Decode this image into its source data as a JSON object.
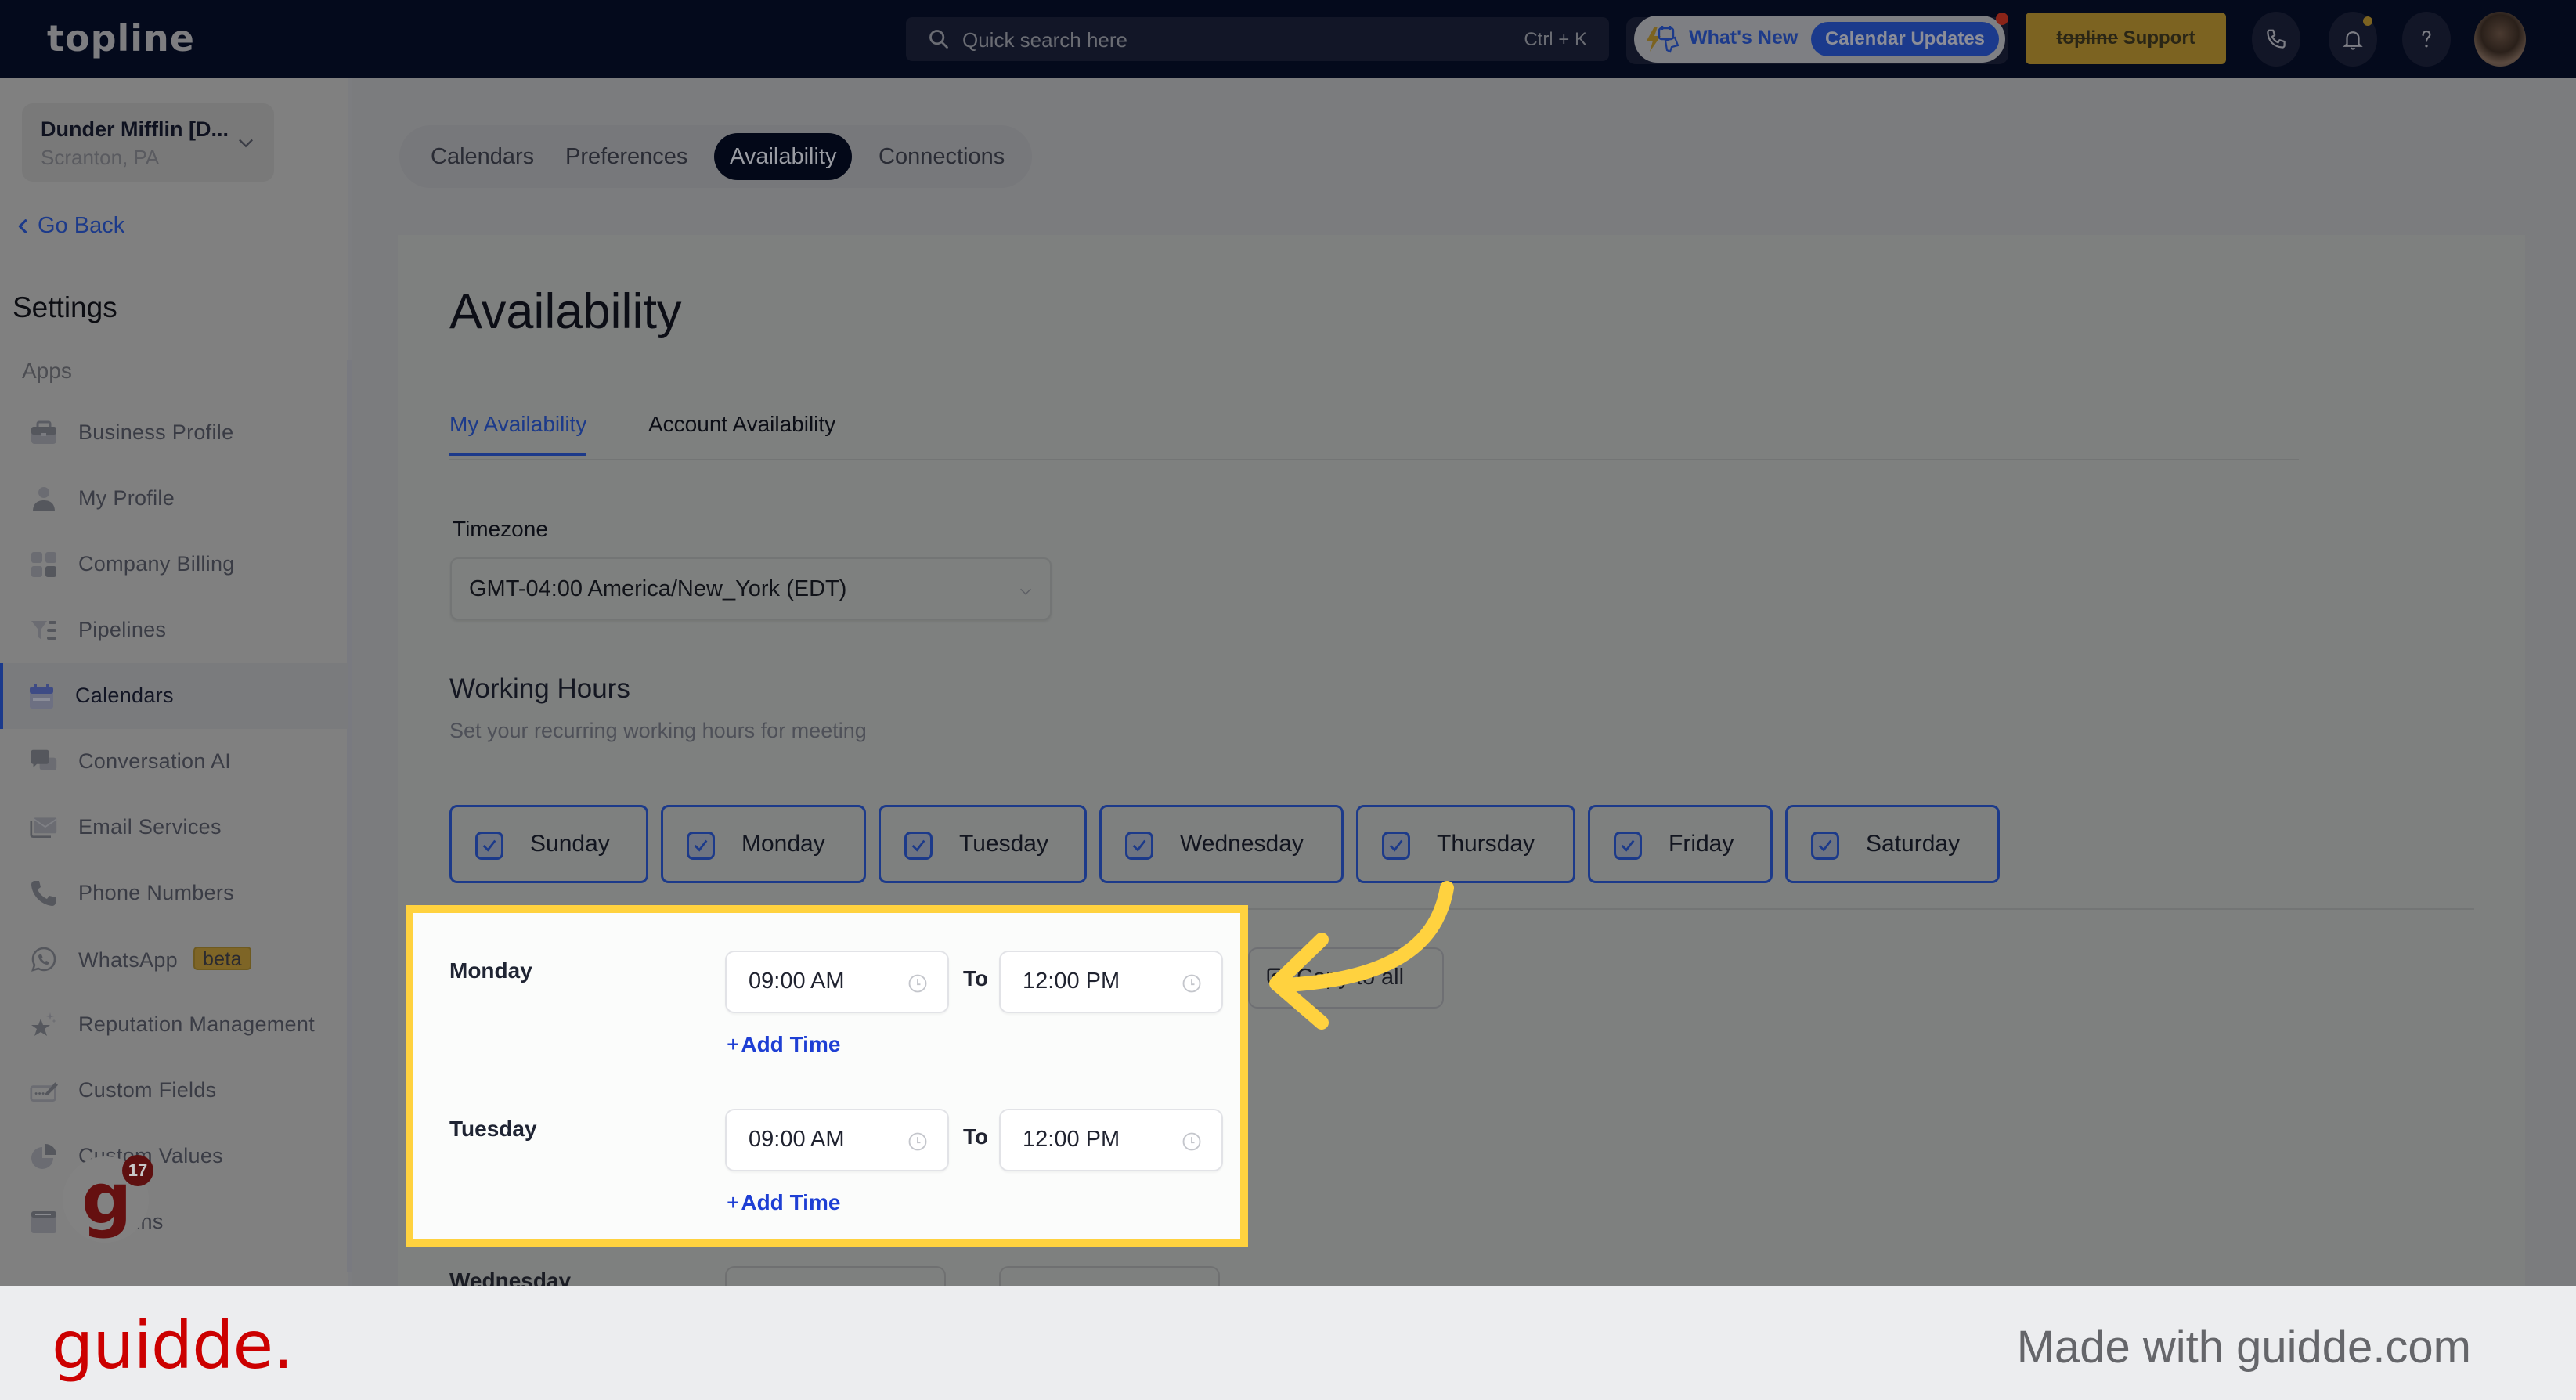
{
  "topbar": {
    "logo": "topline",
    "search_placeholder": "Quick search here",
    "search_shortcut": "Ctrl + K",
    "whats_new_label": "What's New",
    "whats_new_pill": "Calendar Updates",
    "support_brand": "topline",
    "support_label": " Support",
    "icons": [
      "phone-icon",
      "bell-icon",
      "help-icon",
      "avatar"
    ]
  },
  "sidebar": {
    "location_name": "Dunder Mifflin [D...",
    "location_sub": "Scranton, PA",
    "go_back": "Go Back",
    "section_title": "Settings",
    "group_label": "Apps",
    "items": [
      {
        "label": "Business Profile",
        "icon": "briefcase-icon"
      },
      {
        "label": "My Profile",
        "icon": "user-icon"
      },
      {
        "label": "Company Billing",
        "icon": "calculator-icon"
      },
      {
        "label": "Pipelines",
        "icon": "funnel-icon"
      },
      {
        "label": "Calendars",
        "icon": "calendar-icon",
        "active": true
      },
      {
        "label": "Conversation AI",
        "icon": "chat-bubbles-icon"
      },
      {
        "label": "Email Services",
        "icon": "envelope-icon"
      },
      {
        "label": "Phone Numbers",
        "icon": "phone-icon"
      },
      {
        "label": "WhatsApp",
        "icon": "whatsapp-icon",
        "badge": "beta"
      },
      {
        "label": "Reputation Management",
        "icon": "star-sparkle-icon"
      },
      {
        "label": "Custom Fields",
        "icon": "edit-field-icon"
      },
      {
        "label": "Custom Values",
        "icon": "pie-chart-icon"
      },
      {
        "label": "Domains",
        "icon": "browser-window-icon"
      }
    ],
    "fab_badge": "17"
  },
  "main": {
    "top_tabs": [
      {
        "label": "Calendars"
      },
      {
        "label": "Preferences"
      },
      {
        "label": "Availability",
        "active": true
      },
      {
        "label": "Connections"
      }
    ],
    "page_title": "Availability",
    "sub_tabs": [
      {
        "label": "My Availability",
        "active": true
      },
      {
        "label": "Account Availability"
      }
    ],
    "timezone_label": "Timezone",
    "timezone_value": "GMT-04:00 America/New_York (EDT)",
    "working_hours_title": "Working Hours",
    "working_hours_subtitle": "Set your recurring working hours for meeting",
    "days": [
      {
        "label": "Sunday",
        "checked": true
      },
      {
        "label": "Monday",
        "checked": true
      },
      {
        "label": "Tuesday",
        "checked": true
      },
      {
        "label": "Wednesday",
        "checked": true
      },
      {
        "label": "Thursday",
        "checked": true
      },
      {
        "label": "Friday",
        "checked": true
      },
      {
        "label": "Saturday",
        "checked": true
      }
    ],
    "copy_to_all": "Copy to all",
    "schedule": [
      {
        "day": "Monday",
        "from": "09:00 AM",
        "to_label": "To",
        "to": "12:00 PM",
        "add_time": "Add Time"
      },
      {
        "day": "Tuesday",
        "from": "09:00 AM",
        "to_label": "To",
        "to": "12:00 PM",
        "add_time": "Add Time"
      },
      {
        "day": "Wednesday"
      }
    ]
  },
  "footer": {
    "logo": "guidde.",
    "made_with": "Made with guidde.com"
  },
  "colors": {
    "accent_blue": "#1c3a8a",
    "link_blue": "#1e3fd4",
    "highlight_yellow": "#ffd23f",
    "guidde_red": "#cc0000",
    "topbar_bg": "#040a1c"
  }
}
